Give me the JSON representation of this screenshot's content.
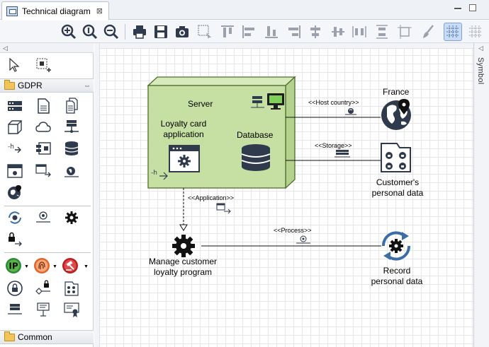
{
  "tab": {
    "title": "Technical diagram",
    "close": "⊠"
  },
  "palette": {
    "group_gdpr": "GDPR",
    "group_common": "Common",
    "collapse_glyph": "◁",
    "head_arrows": "⇔"
  },
  "symbol_panel": {
    "label": "Symbol",
    "collapse_glyph": "◁"
  },
  "diagram": {
    "server": "Server",
    "loyalty_app": "Loyalty card\napplication",
    "database": "Database",
    "france": "France",
    "customer_data": "Customer's\npersonal data",
    "manage_program": "Manage customer\nloyalty program",
    "record_data": "Record\npersonal data",
    "stereo_host_country": "<<Host country>>",
    "stereo_storage": "<<Storage>>",
    "stereo_application": "<<Application>>",
    "stereo_process": "<<Process>>",
    "ip_label": "IP"
  },
  "colors": {
    "node_fill": "#c6e0a3",
    "node_border": "#4f6e2a",
    "icon_dark": "#2f3b4c",
    "accent_blue": "#3a6ea8",
    "grid": "#e6e6e6"
  }
}
